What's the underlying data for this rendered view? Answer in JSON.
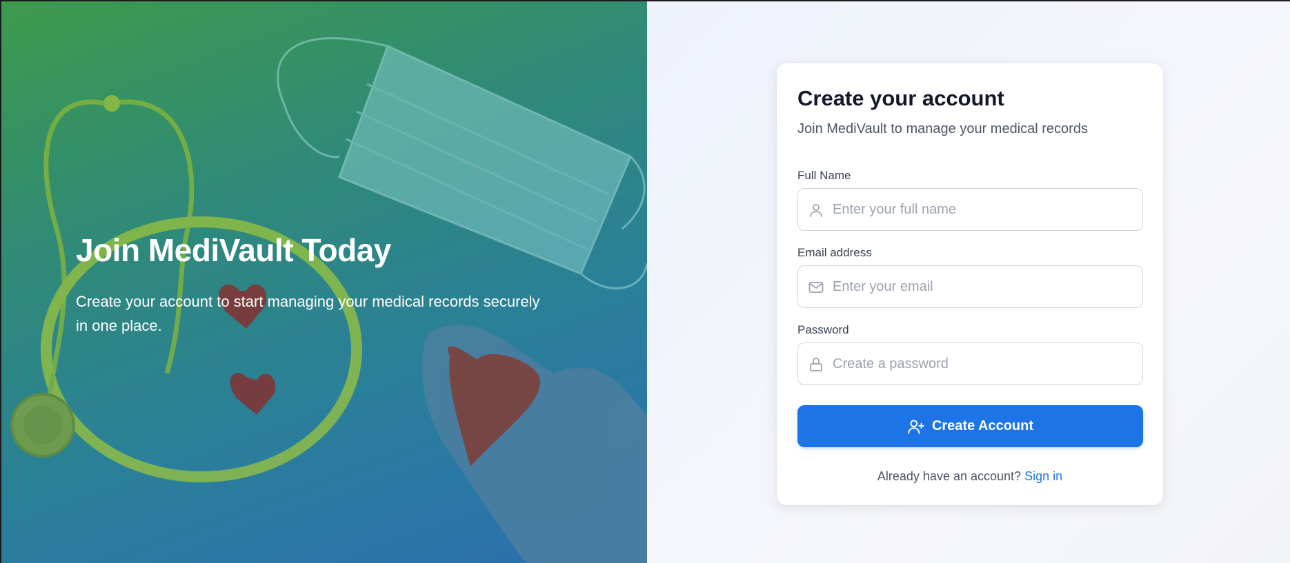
{
  "hero": {
    "title": "Join MediVault Today",
    "subtitle": "Create your account to start managing your medical records securely in one place."
  },
  "form": {
    "title": "Create your account",
    "subtitle": "Join MediVault to manage your medical records",
    "fields": [
      {
        "label": "Full Name",
        "placeholder": "Enter your full name",
        "value": "",
        "icon": "user-icon"
      },
      {
        "label": "Email address",
        "placeholder": "Enter your email",
        "value": "",
        "icon": "mail-icon"
      },
      {
        "label": "Password",
        "placeholder": "Create a password",
        "value": "",
        "icon": "lock-icon"
      }
    ],
    "submit_label": "Create Account",
    "submit_icon": "user-plus-icon",
    "footer_prompt": "Already have an account?",
    "footer_link": "Sign in"
  },
  "colors": {
    "accent": "#1d74e7",
    "hero_gradient_start": "#3d9a4b",
    "hero_gradient_end": "#2b6fb0"
  }
}
